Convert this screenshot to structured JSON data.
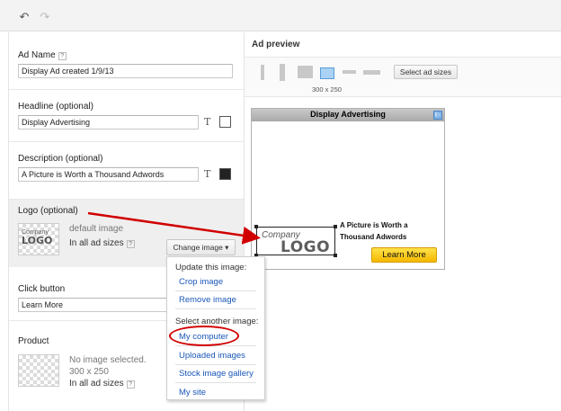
{
  "toolbar": {
    "undo_icon": "undo-icon",
    "redo_icon": "redo-icon"
  },
  "ad_name": {
    "label": "Ad Name",
    "value": "Display Ad created 1/9/13"
  },
  "headline": {
    "label": "Headline (optional)",
    "value": "Display Advertising",
    "text_color": "#ffffff"
  },
  "description": {
    "label": "Description (optional)",
    "value": "A Picture is Worth a Thousand Adwords",
    "text_color": "#222222"
  },
  "logo": {
    "label": "Logo (optional)",
    "thumb_company": "Company",
    "thumb_logo": "LOGO",
    "status": "default image",
    "scope": "In all ad sizes",
    "change_button": "Change image ▾"
  },
  "change_menu": {
    "update_header": "Update this image:",
    "update_items": [
      "Crop image",
      "Remove image"
    ],
    "select_header": "Select another image:",
    "select_items": [
      "My computer",
      "Uploaded images",
      "Stock image gallery",
      "My site"
    ]
  },
  "click_button": {
    "label": "Click button",
    "value": "Learn More"
  },
  "product": {
    "label": "Product",
    "status": "No image selected.",
    "size": "300 x 250",
    "scope": "In all ad sizes"
  },
  "preview": {
    "title": "Ad preview",
    "selected_size": "300 x 250",
    "select_sizes_button": "Select ad sizes",
    "ad": {
      "headline": "Display Advertising",
      "company": "Company",
      "logo_word": "LOGO",
      "description": "A Picture is Worth a Thousand Adwords",
      "cta": "Learn More",
      "adchoices": "i▷"
    }
  },
  "help_glyph": "?",
  "colors": {
    "link": "#1a57b8",
    "annotation": "#d10000",
    "cta": "#f5b800",
    "selected_size": "#a9d2f5"
  }
}
